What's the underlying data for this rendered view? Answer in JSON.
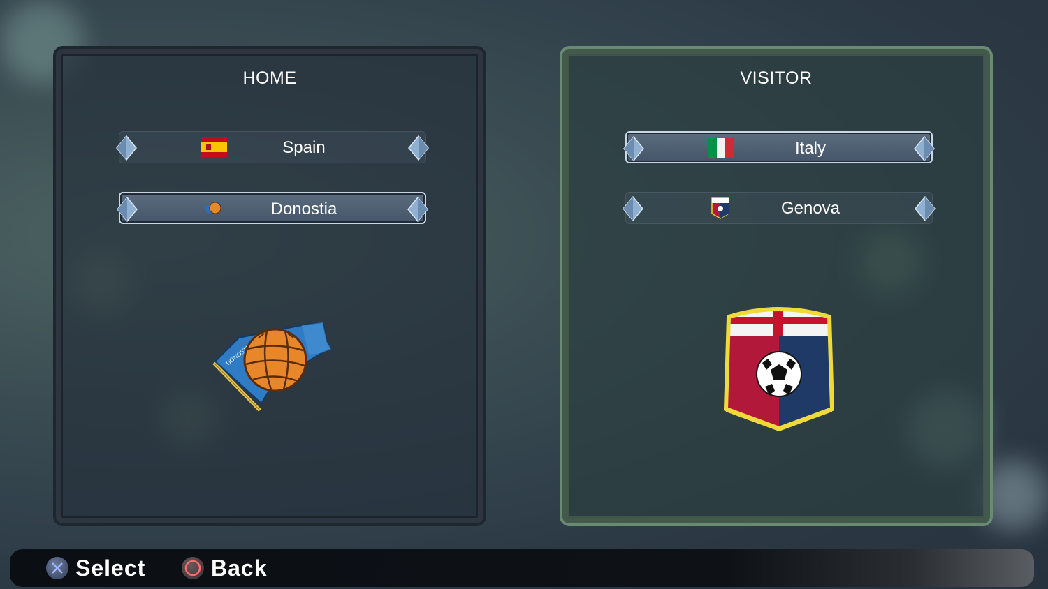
{
  "home": {
    "title": "HOME",
    "country": "Spain",
    "club": "Donostia",
    "country_flag_icon": "spain-flag-icon",
    "club_crest_icon": "donostia-crest-icon"
  },
  "visitor": {
    "title": "VISITOR",
    "country": "Italy",
    "club": "Genova",
    "country_flag_icon": "italy-flag-icon",
    "club_crest_icon": "genova-crest-icon"
  },
  "crest_text": {
    "donostia": "DONOSTIA"
  },
  "controls": {
    "select_label": "Select",
    "back_label": "Back",
    "select_glyph": "cross-button-icon",
    "back_glyph": "circle-button-icon"
  },
  "colors": {
    "accent_home_border": "#1e262e",
    "accent_visitor_border": "#6a8a74",
    "text": "#ffffff"
  }
}
